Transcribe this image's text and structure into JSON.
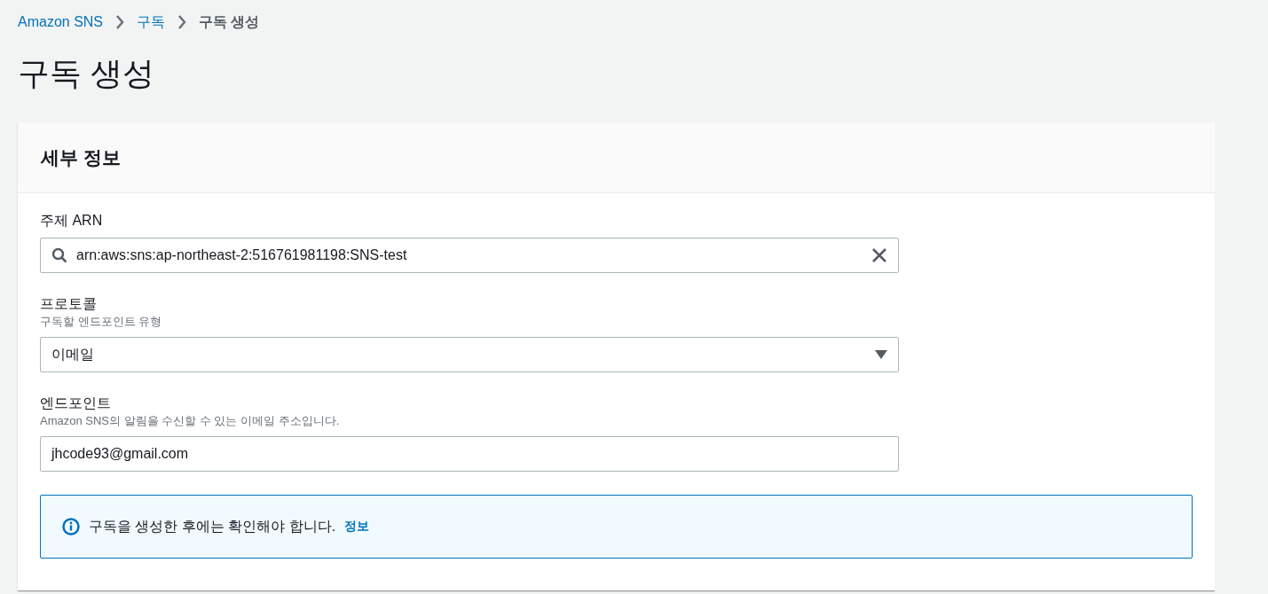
{
  "breadcrumbs": [
    {
      "label": "Amazon SNS",
      "link": true
    },
    {
      "label": "구독",
      "link": true
    },
    {
      "label": "구독 생성",
      "link": false
    }
  ],
  "page_title": "구독 생성",
  "panel": {
    "title": "세부 정보",
    "fields": [
      {
        "kind": "search",
        "label": "주제 ARN",
        "value": "arn:aws:sns:ap-northeast-2:516761981198:SNS-test"
      },
      {
        "kind": "select",
        "label": "프로토콜",
        "description": "구독할 엔드포인트 유형",
        "value": "이메일"
      },
      {
        "kind": "text",
        "label": "엔드포인트",
        "description": "Amazon SNS의 알림을 수신할 수 있는 이메일 주소입니다.",
        "value": "jhcode93@gmail.com"
      }
    ],
    "info": {
      "text": "구독을 생성한 후에는 확인해야 합니다.",
      "link": "정보"
    }
  }
}
